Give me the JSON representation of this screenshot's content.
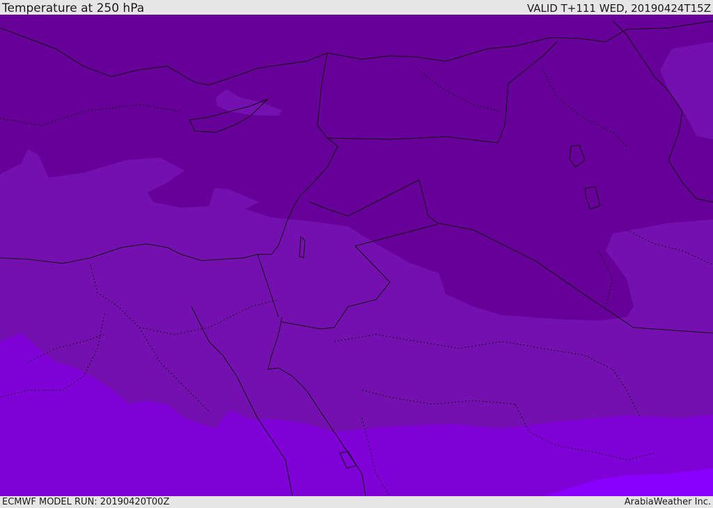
{
  "header": {
    "title": "Temperature at 250 hPa",
    "valid": "VALID T+111 WED, 20190424T15Z"
  },
  "footer": {
    "model_run": "ECMWF MODEL RUN: 20190420T00Z",
    "credit": "ArabiaWeather Inc."
  },
  "map": {
    "field": "Temperature at 250 hPa",
    "colors": {
      "band_coldest": "#660099",
      "band_cold": "#7510b0",
      "band_mid": "#8000d8",
      "band_warm": "#8a00ff",
      "coastline": "#111111",
      "border": "#111111"
    }
  }
}
